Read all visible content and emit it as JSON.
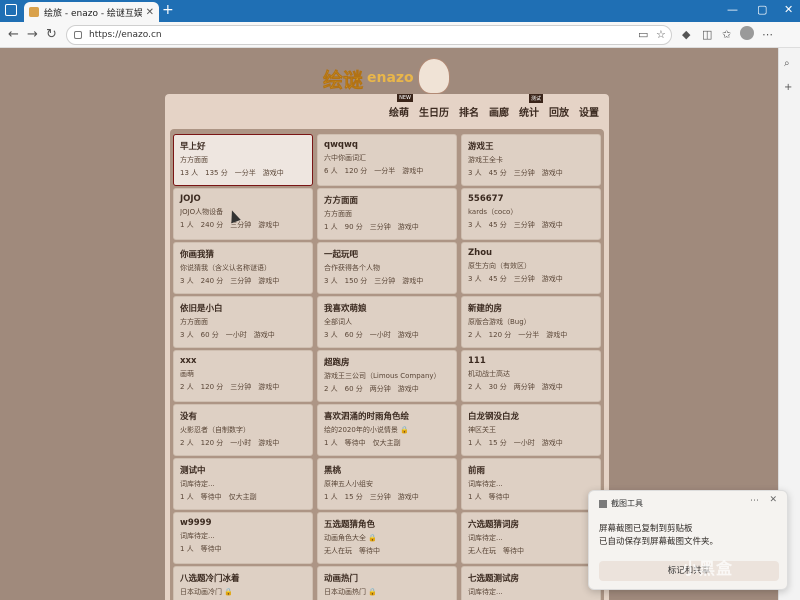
{
  "browser": {
    "tab_title": "绘旅 - enazo - 绘谜互娱 - 你画我猜",
    "url": "https://enazo.cn",
    "search_icon_label": "search"
  },
  "site": {
    "logo_text": "绘谜",
    "logo_sub": "enazo"
  },
  "menu": [
    {
      "label": "绘萌",
      "badge": "NEW"
    },
    {
      "label": "生日历",
      "badge": ""
    },
    {
      "label": "排名",
      "badge": ""
    },
    {
      "label": "画廊",
      "badge": ""
    },
    {
      "label": "统计",
      "badge": "测试"
    },
    {
      "label": "回放",
      "badge": ""
    },
    {
      "label": "设置",
      "badge": ""
    }
  ],
  "rooms": [
    [
      {
        "name": "早上好",
        "desc": "方方面面",
        "meta": "13 人　135 分　一分半　游戏中"
      },
      {
        "name": "qwqwq",
        "desc": "六中你画词汇",
        "meta": "6 人　120 分　一分半　游戏中"
      },
      {
        "name": "游戏王",
        "desc": "游戏王全卡",
        "meta": "3 人　45 分　三分钟　游戏中"
      }
    ],
    [
      {
        "name": "JOJO",
        "desc": "JOJO人物设备",
        "meta": "1 人　240 分　三分钟　游戏中"
      },
      {
        "name": "方方面面",
        "desc": "方方面面",
        "meta": "1 人　90 分　三分钟　游戏中"
      },
      {
        "name": "556677",
        "desc": "kards（coco）",
        "meta": "3 人　45 分　三分钟　游戏中"
      }
    ],
    [
      {
        "name": "你画我猜",
        "desc": "你说猜我（含义认名称谜语）",
        "meta": "3 人　240 分　三分钟　游戏中"
      },
      {
        "name": "一起玩吧",
        "desc": "合作获得各个人物",
        "meta": "3 人　150 分　三分钟　游戏中"
      },
      {
        "name": "Zhou",
        "desc": "原生方向（有效区）",
        "meta": "3 人　45 分　三分钟　游戏中"
      }
    ],
    [
      {
        "name": "依旧是小白",
        "desc": "方方面面",
        "meta": "3 人　60 分　一小时　游戏中"
      },
      {
        "name": "我喜欢萌娘",
        "desc": "全部词人",
        "meta": "3 人　60 分　一小时　游戏中"
      },
      {
        "name": "新建的房",
        "desc": "原版合游戏（Bug）",
        "meta": "2 人　120 分　一分半　游戏中"
      }
    ],
    [
      {
        "name": "xxx",
        "desc": "画萌",
        "meta": "2 人　120 分　三分钟　游戏中"
      },
      {
        "name": "超跑房",
        "desc": "游戏王三公司（Limous Company）",
        "meta": "2 人　60 分　两分钟　游戏中"
      },
      {
        "name": "111",
        "desc": "机动战士高达",
        "meta": "2 人　30 分　两分钟　游戏中"
      }
    ],
    [
      {
        "name": "没有",
        "desc": "火影忍者（自制数字）",
        "meta": "2 人　120 分　一小时　游戏中"
      },
      {
        "name": "喜欢泗涌的时雨角色绘",
        "desc": "绘的2020年的小说情景 🔒",
        "meta": "1 人　等待中　仅大主副"
      },
      {
        "name": "白龙钢没白龙",
        "desc": "神区关王",
        "meta": "1 人　15 分　一小时　游戏中"
      }
    ],
    [
      {
        "name": "测试中",
        "desc": "词库待定...",
        "meta": "1 人　等待中　仅大主副"
      },
      {
        "name": "黑桃",
        "desc": "原神五人小组安",
        "meta": "1 人　15 分　三分钟　游戏中"
      },
      {
        "name": "前雨",
        "desc": "词库待定...",
        "meta": "1 人　等待中"
      }
    ],
    [
      {
        "name": "w9999",
        "desc": "词库待定...",
        "meta": "1 人　等待中"
      },
      {
        "name": "五选题猜角色",
        "desc": "动画角色大全 🔒",
        "meta": "无人在玩　等待中"
      },
      {
        "name": "六选题猜词房",
        "desc": "词库待定...",
        "meta": "无人在玩　等待中"
      }
    ],
    [
      {
        "name": "八选题冷门冰着",
        "desc": "日本动画冷门 🔒",
        "meta": ""
      },
      {
        "name": "动画热门",
        "desc": "日本动画热门 🔒",
        "meta": ""
      },
      {
        "name": "七选题测试房",
        "desc": "词库待定...",
        "meta": ""
      }
    ]
  ],
  "toast": {
    "app": "截图工具",
    "line1": "屏幕截图已复制到剪贴板",
    "line2": "已自动保存到屏幕截图文件夹。",
    "button": "标记和共享"
  },
  "watermark": "小黑盒"
}
